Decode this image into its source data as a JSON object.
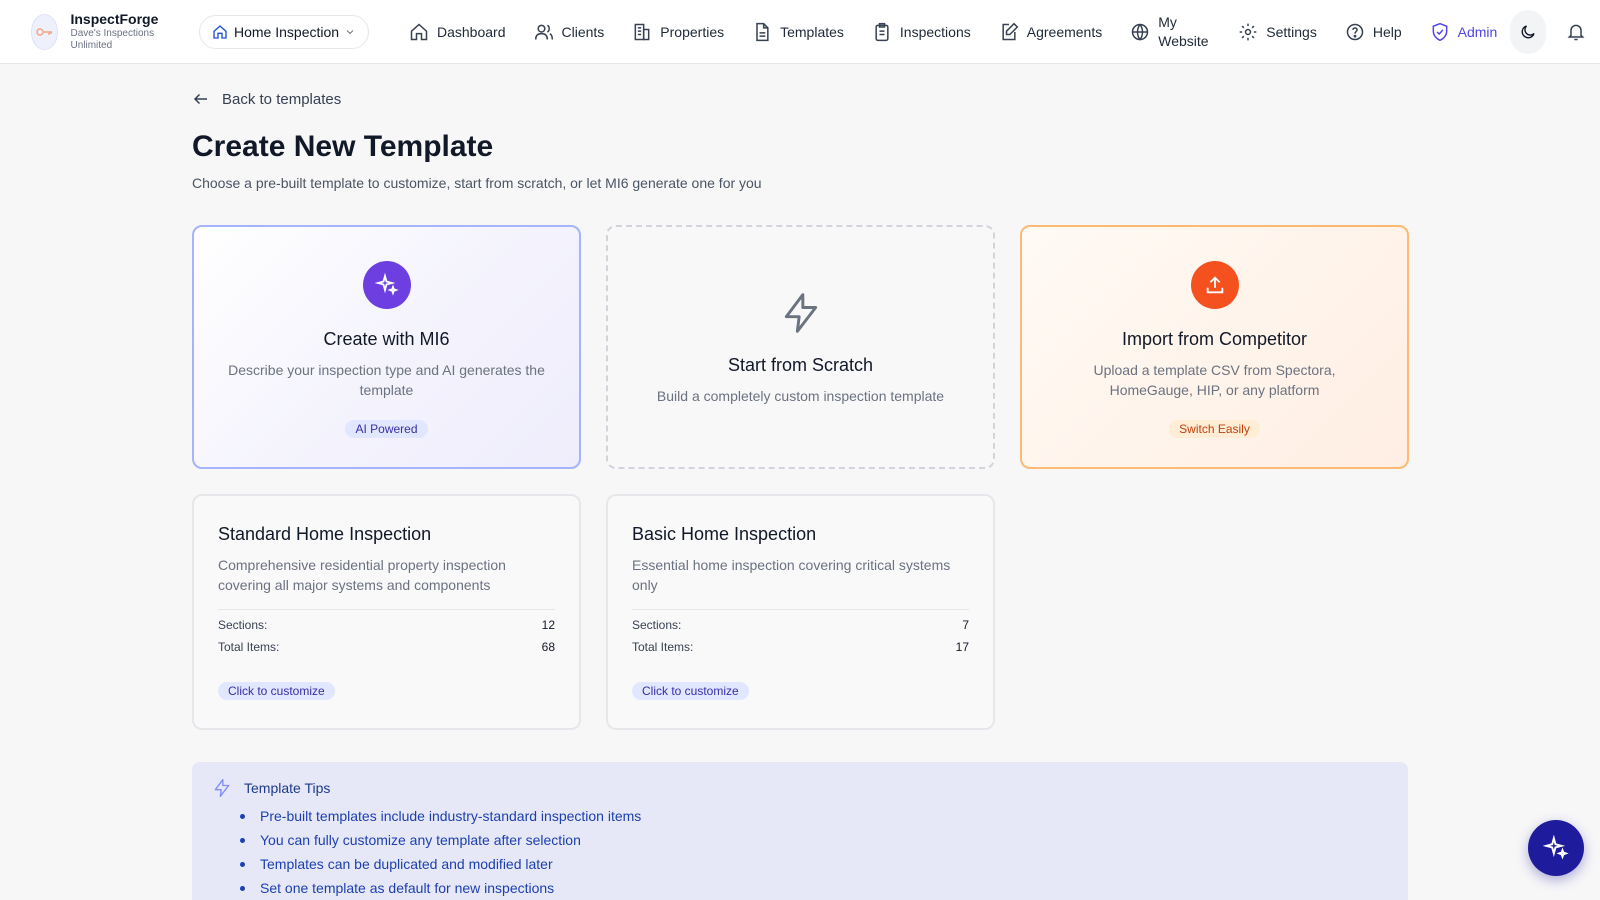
{
  "brand": {
    "name": "InspectForge",
    "subtitle": "Dave's Inspections Unlimited",
    "logo_icon": "key-icon"
  },
  "org_select": {
    "value": "Home Inspection",
    "icon": "home-icon"
  },
  "nav": {
    "items": [
      {
        "label": "Dashboard",
        "icon": "home-icon"
      },
      {
        "label": "Clients",
        "icon": "users-icon"
      },
      {
        "label": "Properties",
        "icon": "building-icon"
      },
      {
        "label": "Templates",
        "icon": "document-icon"
      },
      {
        "label": "Inspections",
        "icon": "clipboard-icon"
      },
      {
        "label": "Agreements",
        "icon": "edit-document-icon"
      },
      {
        "label": "My Website",
        "icon": "globe-icon"
      },
      {
        "label": "Settings",
        "icon": "gear-icon"
      },
      {
        "label": "Help",
        "icon": "help-circle-icon"
      },
      {
        "label": "Admin",
        "icon": "shield-icon"
      }
    ]
  },
  "header_actions": {
    "theme_icon": "moon-icon",
    "notifications_icon": "bell-icon"
  },
  "back_link": "Back to templates",
  "page": {
    "title": "Create New Template",
    "subtitle": "Choose a pre-built template to customize, start from scratch, or let MI6 generate one for you"
  },
  "options": {
    "ai": {
      "title": "Create with MI6",
      "description": "Describe your inspection type and AI generates the template",
      "badge": "AI Powered",
      "icon": "sparkles-icon"
    },
    "scratch": {
      "title": "Start from Scratch",
      "description": "Build a completely custom inspection template",
      "icon": "lightning-icon"
    },
    "import": {
      "title": "Import from Competitor",
      "description": "Upload a template CSV from Spectora, HomeGauge, HIP, or any platform",
      "badge": "Switch Easily",
      "icon": "upload-icon"
    }
  },
  "templates": [
    {
      "title": "Standard Home Inspection",
      "description": "Comprehensive residential property inspection covering all major systems and components",
      "sections_label": "Sections:",
      "sections": "12",
      "items_label": "Total Items:",
      "items": "68",
      "cta": "Click to customize"
    },
    {
      "title": "Basic Home Inspection",
      "description": "Essential home inspection covering critical systems only",
      "sections_label": "Sections:",
      "sections": "7",
      "items_label": "Total Items:",
      "items": "17",
      "cta": "Click to customize"
    }
  ],
  "tips": {
    "title": "Template Tips",
    "items": [
      "Pre-built templates include industry-standard inspection items",
      "You can fully customize any template after selection",
      "Templates can be duplicated and modified later",
      "Set one template as default for new inspections"
    ]
  },
  "fab": {
    "icon": "sparkles-icon"
  },
  "colors": {
    "accent": "#4f46e5",
    "ai_purple": "#6d3fe0",
    "import_orange": "#f4511e",
    "fab_navy": "#1e1b9c"
  }
}
